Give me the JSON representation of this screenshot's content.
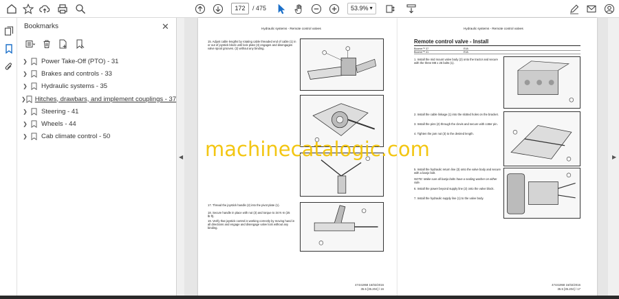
{
  "toolbar": {
    "current_page": "172",
    "total_pages": "/ 475",
    "zoom": "53.9%"
  },
  "bookmarks": {
    "title": "Bookmarks",
    "close": "✕",
    "items": [
      {
        "label": "Power Take-Off (PTO) - 31"
      },
      {
        "label": "Brakes and controls - 33"
      },
      {
        "label": "Hydraulic systems - 35"
      },
      {
        "label": "Hitches, drawbars, and implement couplings - 37"
      },
      {
        "label": "Steering - 41"
      },
      {
        "label": "Wheels - 44"
      },
      {
        "label": "Cab climate control - 50"
      }
    ]
  },
  "left_page": {
    "header": "Hydraulic systems - Remote control valves",
    "steps": [
      "15.  Adjust cable lengths by rotating cable threaded end of cable (1) in or out of joystick block until lock plate (3) engages and disengages valve spool grooves. (2) without any binding.",
      "17.  Thread the joystick handle (2) into the pivot plate (1).",
      "18.  Secure handle in place with nut (3) and torque to 34 N·m (25 lb·ft).",
      "19.  Verify that joystick control is working correctly by moving hand in all directions and engage and disengage valve lock without any binding."
    ],
    "footer_line1": "47441958 16/02/2016",
    "footer_line2": "35.5 [35.204] / 16"
  },
  "right_page": {
    "header": "Hydraulic systems - Remote control valves",
    "section_title": "Remote control valve - Install",
    "table_rows": [
      [
        "Boomer™ 37",
        "EVA"
      ],
      [
        "Boomer™ 41",
        "EVA"
      ]
    ],
    "steps": [
      "1.  Install the mid mount valve body (2) onto the tractor and secure with the three M8 x 25 bolts (1).",
      "2.  Install the cable linkage (1) into the slotted holes on the bracket.",
      "3.  Install the pins (2) through the clevis and secure with cotter pin.",
      "4.  Tighten the jam nut (3) to the desired length.",
      "5.  Install the hydraulic return line (3) onto the valve body and secure with a banjo bolt.",
      "NOTE: Make sure all banjo bolts have a sealing washer on either side.",
      "6.  Install the power beyond supply line (2) onto the valve block.",
      "7.  Install the hydraulic supply line (1) to the valve body."
    ],
    "footer_line1": "47441958 16/02/2016",
    "footer_line2": "35.5 [35.204] / 17"
  },
  "watermark": "machinecatalogic.com"
}
